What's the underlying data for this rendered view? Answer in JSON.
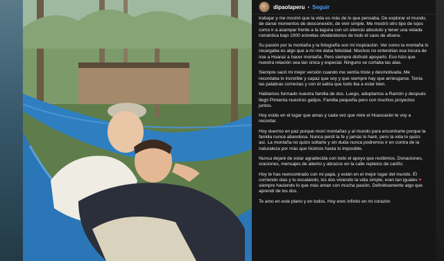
{
  "post": {
    "username": "dipaolaperu",
    "separator": "•",
    "follow_label": "Seguir",
    "caption_top": "trabajar y me mostró que la vida es más de lo que pensaba. De explorar el mundo, de darse momentos de desconexión, de vivir simple. Me mostró otro tipo de lujos como ir a acampar frente a la laguna con un silencio absoluto y tener una velada romántica bajo 1000 estrellas olvidándonos de todo el caos de afuera.",
    "paragraphs": [
      "Su pasión por la montaña y la fotografía son mi inspiración. Ver como la montaña lo recargaba es algo que a mi me daba felicidad. Muchos no entendían esa locura de irse a Huaraz a hacer montaña. Pero siempre disfruté apoyarlo. Eso hizo que nuestra relación sea tan única y especial. Ninguno se cortaba las alas.",
      "Siempre sacó mi mejor versión cuando me sentía triste y desmotivada. Me recordaba lo increíble y capaz que soy y que siempre hay que arriesgarse. Tenía las palabras correctas y con él sabía que todo iba a estar bien.",
      "Hablamos formado nuestra familia de dos. Luego, adoptamos a Ramón y después llegó Pimienta nuestros gatijos. Familia pequeña pero con muchos proyectos juntos.",
      "Hoy estás en el lugar que amas y cada vez que mire el Huascarán te voy a recordar.",
      "Hoy duermo en paz porque moví montañas y al mundo para encontrarte porque la familia nunca abandona. Nunca perdí la fe y jamás lo haré, pero la vida lo quizo así. La montaña no quizo soltarte y sin duda nunca podremos ir en contra de la naturaleza por más que hicimos hasta lo imposible.",
      "Nunca dejaré de estar agradecida con todo el apoyo que recibimos. Donaciones, oraciones, mensajes de aliento y abrazos en la calle repletos de cariño."
    ],
    "last_paragraph_before_heart": "Hoy te has reencontrado con mi papá, y están en el mejor lugar del mundo. Él corriendo olas y tu escalando, los dos viviendo la vida simple, eran tan iguales",
    "heart_glyph": "♥",
    "last_paragraph_after_heart": " siempre haciendo lo que más aman con mucha pasión. Definitivamente algo que aprendí de los dos.",
    "final_line": "Te amo en este plano y en todos. Hoy eres infinito en mi corazón"
  },
  "colors": {
    "follow": "#4aa3ff",
    "heart": "#ff3d8b",
    "hammock": "#2f7fc0"
  },
  "icons": {
    "next": "chevron-right-icon"
  }
}
